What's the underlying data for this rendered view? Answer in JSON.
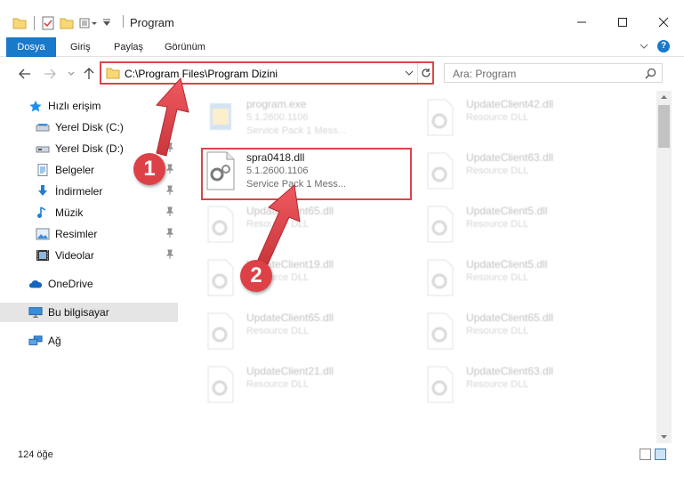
{
  "window": {
    "title": "Program"
  },
  "ribbon": {
    "tabs": [
      "Dosya",
      "Giriş",
      "Paylaş",
      "Görünüm"
    ],
    "help_label": "?"
  },
  "address": {
    "path": "C:\\Program Files\\Program Dizini"
  },
  "search": {
    "placeholder": "Ara: Program"
  },
  "sidebar": {
    "quick_access": "Hızlı erişim",
    "items": [
      {
        "label": "Yerel Disk (C:)",
        "icon": "drive-icon"
      },
      {
        "label": "Yerel Disk (D:)",
        "icon": "drive-icon"
      },
      {
        "label": "Belgeler",
        "icon": "documents-icon"
      },
      {
        "label": "İndirmeler",
        "icon": "downloads-icon"
      },
      {
        "label": "Müzik",
        "icon": "music-icon"
      },
      {
        "label": "Resimler",
        "icon": "pictures-icon"
      },
      {
        "label": "Videolar",
        "icon": "videos-icon"
      }
    ],
    "onedrive": "OneDrive",
    "this_pc": "Bu bilgisayar",
    "network": "Ağ"
  },
  "files": [
    {
      "name": "program.exe",
      "line1": "5.1.2600.1106",
      "line2": "Service Pack 1 Mess...",
      "faded": true
    },
    {
      "name": "UpdateClient42.dll",
      "line1": "Resource DLL",
      "line2": "",
      "faded": true
    },
    {
      "name": "spra0418.dll",
      "line1": "5.1.2600.1106",
      "line2": "Service Pack 1 Mess...",
      "faded": false
    },
    {
      "name": "UpdateClient63.dll",
      "line1": "Resource DLL",
      "line2": "",
      "faded": true
    },
    {
      "name": "UpdateClient65.dll",
      "line1": "Resource DLL",
      "line2": "",
      "faded": true
    },
    {
      "name": "UpdateClient5.dll",
      "line1": "Resource DLL",
      "line2": "",
      "faded": true
    },
    {
      "name": "UpdateClient19.dll",
      "line1": "Resource DLL",
      "line2": "",
      "faded": true
    },
    {
      "name": "UpdateClient5.dll",
      "line1": "Resource DLL",
      "line2": "",
      "faded": true
    },
    {
      "name": "UpdateClient65.dll",
      "line1": "Resource DLL",
      "line2": "",
      "faded": true
    },
    {
      "name": "UpdateClient65.dll",
      "line1": "Resource DLL",
      "line2": "",
      "faded": true
    },
    {
      "name": "UpdateClient21.dll",
      "line1": "Resource DLL",
      "line2": "",
      "faded": true
    },
    {
      "name": "UpdateClient63.dll",
      "line1": "Resource DLL",
      "line2": "",
      "faded": true
    }
  ],
  "status": {
    "count": "124 öğe"
  },
  "callouts": [
    "1",
    "2"
  ],
  "colors": {
    "accent": "#1979ca",
    "highlight": "#d9454b",
    "callout": "#dd4147"
  }
}
